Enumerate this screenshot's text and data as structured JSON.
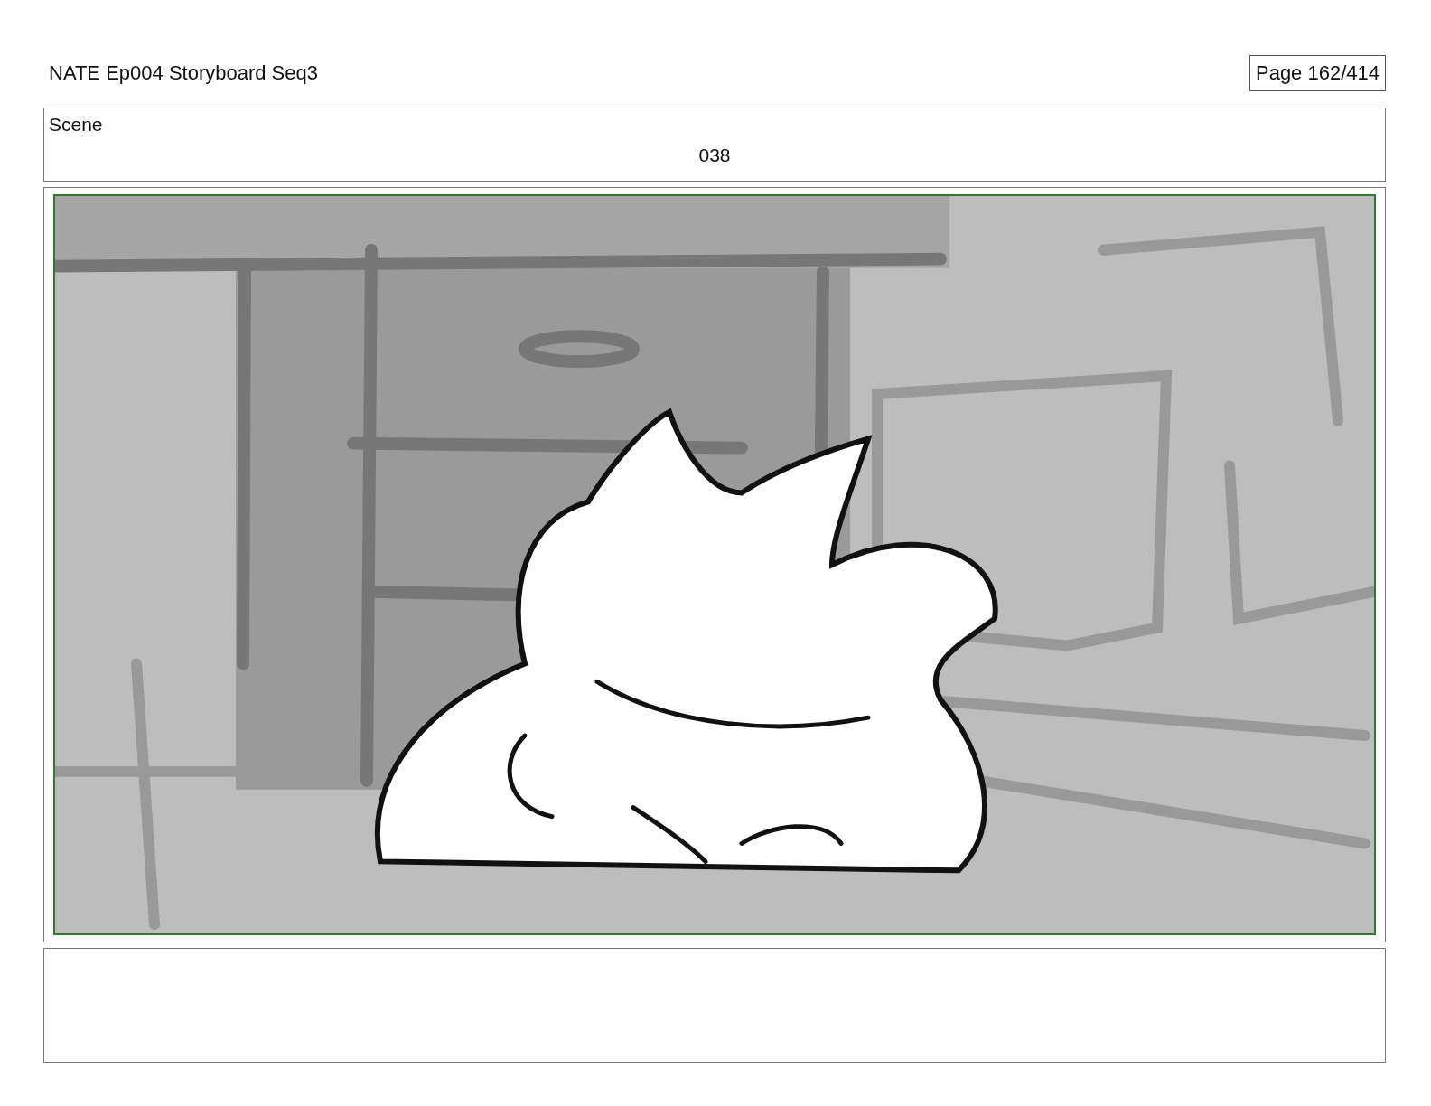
{
  "header": {
    "title": "NATE Ep004 Storyboard Seq3",
    "page": "Page 162/414"
  },
  "scene": {
    "label": "Scene",
    "number": "038"
  }
}
